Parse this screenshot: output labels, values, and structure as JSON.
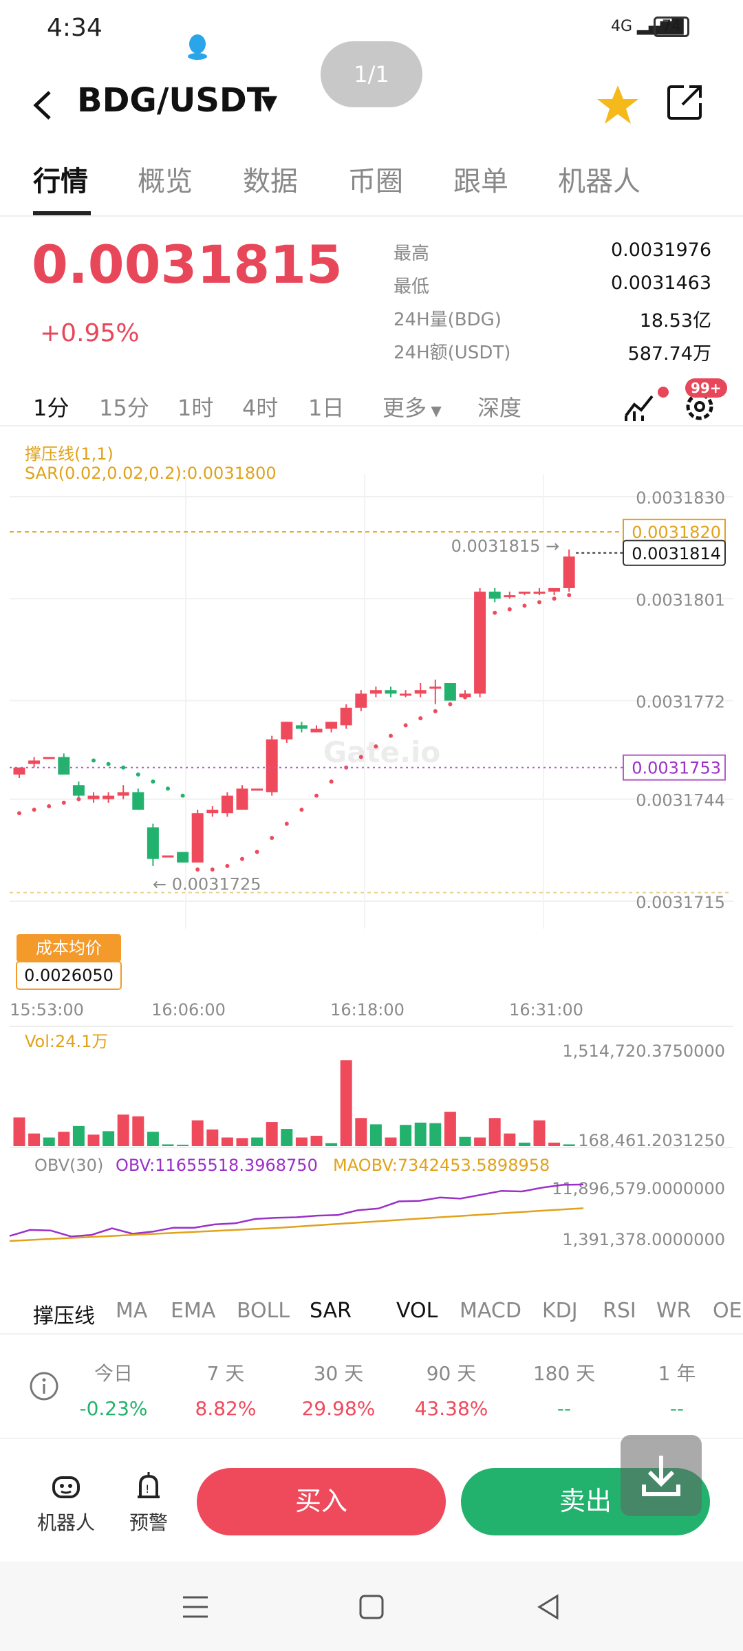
{
  "status_bar": {
    "time": "4:34",
    "signal": "4G",
    "battery": "74"
  },
  "page_indicator": "1/1",
  "header": {
    "pair": "BDG/USDT"
  },
  "tabs": [
    "行情",
    "概览",
    "数据",
    "币圈",
    "跟单",
    "机器人"
  ],
  "price": {
    "last": "0.0031815",
    "change": "+0.95%"
  },
  "stats": [
    {
      "label": "最高",
      "value": "0.0031976"
    },
    {
      "label": "最低",
      "value": "0.0031463"
    },
    {
      "label": "24H量(BDG)",
      "value": "18.53亿"
    },
    {
      "label": "24H额(USDT)",
      "value": "587.74万"
    }
  ],
  "intervals": [
    "1分",
    "15分",
    "1时",
    "4时",
    "1日",
    "更多",
    "深度"
  ],
  "badge_count": "99+",
  "colors": {
    "up": "#ef4a5c",
    "down": "#22b26e",
    "accent": "#e0a21a",
    "obv": "#9b30c8"
  },
  "chart_labels": {
    "support_line": "撑压线(1,1)",
    "sar": "SAR(0.02,0.02,0.2):0.0031800",
    "watermark": "Gate.io",
    "cost_avg_label": "成本均价",
    "cost_avg_value": "0.0026050",
    "last_price_tag": "0.0031815 →",
    "low_tag": "← 0.0031725",
    "vol_label": "Vol:24.1万",
    "obv_title": "OBV(30)",
    "obv_value": "OBV:11655518.3968750",
    "maobv_value": "MAOBV:7342453.5898958"
  },
  "chart_data": [
    {
      "type": "candlestick",
      "title": "",
      "x_ticks": [
        "15:53:00",
        "16:06:00",
        "16:18:00",
        "16:31:00"
      ],
      "y_ticks": [
        "0.0031830",
        "0.0031801",
        "0.0031772",
        "0.0031744",
        "0.0031715"
      ],
      "ylim": [
        0.0031715,
        0.003183
      ],
      "price_tags": [
        "0.0031820",
        "0.0031814",
        "0.0031753"
      ],
      "candles": [
        {
          "o": 0.0031751,
          "c": 0.0031753,
          "h": 0.0031753,
          "l": 0.003175
        },
        {
          "o": 0.0031754,
          "c": 0.0031755,
          "h": 0.0031756,
          "l": 0.0031753
        },
        {
          "o": 0.0031756,
          "c": 0.0031756,
          "h": 0.0031756,
          "l": 0.0031756
        },
        {
          "o": 0.0031756,
          "c": 0.0031751,
          "h": 0.0031757,
          "l": 0.0031751
        },
        {
          "o": 0.0031748,
          "c": 0.0031745,
          "h": 0.0031749,
          "l": 0.0031744
        },
        {
          "o": 0.0031744,
          "c": 0.0031745,
          "h": 0.0031746,
          "l": 0.0031743
        },
        {
          "o": 0.0031744,
          "c": 0.0031745,
          "h": 0.0031746,
          "l": 0.0031743
        },
        {
          "o": 0.0031745,
          "c": 0.0031746,
          "h": 0.0031748,
          "l": 0.0031744
        },
        {
          "o": 0.0031746,
          "c": 0.0031741,
          "h": 0.0031747,
          "l": 0.0031741
        },
        {
          "o": 0.0031736,
          "c": 0.0031727,
          "h": 0.0031737,
          "l": 0.0031725
        },
        {
          "o": 0.0031728,
          "c": 0.0031728,
          "h": 0.0031728,
          "l": 0.0031728
        },
        {
          "o": 0.0031729,
          "c": 0.0031726,
          "h": 0.0031729,
          "l": 0.0031726
        },
        {
          "o": 0.0031726,
          "c": 0.003174,
          "h": 0.0031741,
          "l": 0.0031726
        },
        {
          "o": 0.003174,
          "c": 0.0031741,
          "h": 0.0031742,
          "l": 0.0031739
        },
        {
          "o": 0.003174,
          "c": 0.0031745,
          "h": 0.0031746,
          "l": 0.0031739
        },
        {
          "o": 0.0031741,
          "c": 0.0031747,
          "h": 0.0031748,
          "l": 0.0031741
        },
        {
          "o": 0.0031747,
          "c": 0.0031747,
          "h": 0.0031747,
          "l": 0.0031747
        },
        {
          "o": 0.0031746,
          "c": 0.0031761,
          "h": 0.0031762,
          "l": 0.0031745
        },
        {
          "o": 0.0031761,
          "c": 0.0031766,
          "h": 0.0031766,
          "l": 0.003176
        },
        {
          "o": 0.0031765,
          "c": 0.0031764,
          "h": 0.0031766,
          "l": 0.0031763
        },
        {
          "o": 0.0031763,
          "c": 0.0031764,
          "h": 0.0031765,
          "l": 0.0031763
        },
        {
          "o": 0.0031764,
          "c": 0.0031766,
          "h": 0.0031766,
          "l": 0.0031763
        },
        {
          "o": 0.0031765,
          "c": 0.003177,
          "h": 0.0031771,
          "l": 0.0031764
        },
        {
          "o": 0.003177,
          "c": 0.0031774,
          "h": 0.0031775,
          "l": 0.0031769
        },
        {
          "o": 0.0031774,
          "c": 0.0031775,
          "h": 0.0031776,
          "l": 0.0031773
        },
        {
          "o": 0.0031775,
          "c": 0.0031774,
          "h": 0.0031776,
          "l": 0.0031773
        },
        {
          "o": 0.0031774,
          "c": 0.0031774,
          "h": 0.0031775,
          "l": 0.0031773
        },
        {
          "o": 0.0031774,
          "c": 0.0031775,
          "h": 0.0031777,
          "l": 0.0031773
        },
        {
          "o": 0.0031776,
          "c": 0.0031776,
          "h": 0.0031778,
          "l": 0.0031771
        },
        {
          "o": 0.0031777,
          "c": 0.0031772,
          "h": 0.0031777,
          "l": 0.0031772
        },
        {
          "o": 0.0031773,
          "c": 0.0031774,
          "h": 0.0031775,
          "l": 0.0031773
        },
        {
          "o": 0.0031774,
          "c": 0.0031803,
          "h": 0.0031804,
          "l": 0.0031773
        },
        {
          "o": 0.0031803,
          "c": 0.0031801,
          "h": 0.0031804,
          "l": 0.00318
        },
        {
          "o": 0.0031802,
          "c": 0.0031802,
          "h": 0.0031803,
          "l": 0.0031801
        },
        {
          "o": 0.0031803,
          "c": 0.0031803,
          "h": 0.0031803,
          "l": 0.0031802
        },
        {
          "o": 0.0031803,
          "c": 0.0031803,
          "h": 0.0031804,
          "l": 0.0031802
        },
        {
          "o": 0.0031803,
          "c": 0.0031804,
          "h": 0.0031804,
          "l": 0.0031802
        },
        {
          "o": 0.0031804,
          "c": 0.0031813,
          "h": 0.0031815,
          "l": 0.0031803
        }
      ]
    },
    {
      "type": "bar",
      "title": "Vol",
      "y_ticks": [
        "1,514,720.3750000",
        "168,461.2031250"
      ],
      "ylim": [
        0,
        1514720
      ],
      "values": [
        500000,
        220000,
        150000,
        250000,
        350000,
        200000,
        260000,
        550000,
        520000,
        250000,
        30000,
        0,
        450000,
        290000,
        150000,
        140000,
        150000,
        420000,
        300000,
        150000,
        180000,
        50000,
        1500000,
        490000,
        380000,
        150000,
        370000,
        410000,
        400000,
        600000,
        160000,
        150000,
        490000,
        220000,
        60000,
        450000,
        60000,
        30000
      ],
      "colors": [
        "up",
        "up",
        "down",
        "up",
        "down",
        "up",
        "down",
        "up",
        "up",
        "down",
        "down",
        "down",
        "up",
        "up",
        "up",
        "up",
        "down",
        "up",
        "down",
        "up",
        "up",
        "down",
        "up",
        "up",
        "down",
        "up",
        "down",
        "down",
        "down",
        "up",
        "down",
        "up",
        "up",
        "up",
        "down",
        "up",
        "up",
        "down"
      ]
    },
    {
      "type": "line",
      "title": "OBV(30)",
      "y_ticks": [
        "11,896,579.0000000",
        "1,391,378.0000000"
      ],
      "ylim": [
        1391378,
        11896579
      ],
      "series": [
        {
          "name": "OBV",
          "values": [
            2300000,
            3400000,
            3300000,
            2200000,
            2500000,
            3700000,
            2700000,
            3100000,
            3800000,
            3800000,
            4400000,
            4600000,
            5400000,
            5600000,
            5700000,
            6000000,
            6100000,
            7000000,
            7300000,
            8600000,
            8700000,
            9300000,
            9100000,
            9800000,
            10500000,
            10400000,
            11100000,
            11600000,
            11655518
          ]
        },
        {
          "name": "MAOBV",
          "values": [
            1391378,
            1700000,
            2000000,
            2300000,
            2600000,
            2900000,
            3200000,
            3500000,
            3800000,
            4200000,
            4600000,
            5000000,
            5400000,
            5800000,
            6200000,
            6600000,
            7000000,
            7342453
          ]
        }
      ]
    }
  ],
  "indicator_tabs": [
    "撑压线",
    "MA",
    "EMA",
    "BOLL",
    "SAR",
    "VOL",
    "MACD",
    "KDJ",
    "RSI",
    "WR",
    "OE"
  ],
  "performance": [
    {
      "label": "今日",
      "value": "-0.23%",
      "dir": "down"
    },
    {
      "label": "7 天",
      "value": "8.82%",
      "dir": "up"
    },
    {
      "label": "30 天",
      "value": "29.98%",
      "dir": "up"
    },
    {
      "label": "90 天",
      "value": "43.38%",
      "dir": "up"
    },
    {
      "label": "180 天",
      "value": "--",
      "dir": "down"
    },
    {
      "label": "1 年",
      "value": "--",
      "dir": "down"
    }
  ],
  "bottom": {
    "robot": "机器人",
    "alert": "预警",
    "buy": "买入",
    "sell": "卖出"
  }
}
